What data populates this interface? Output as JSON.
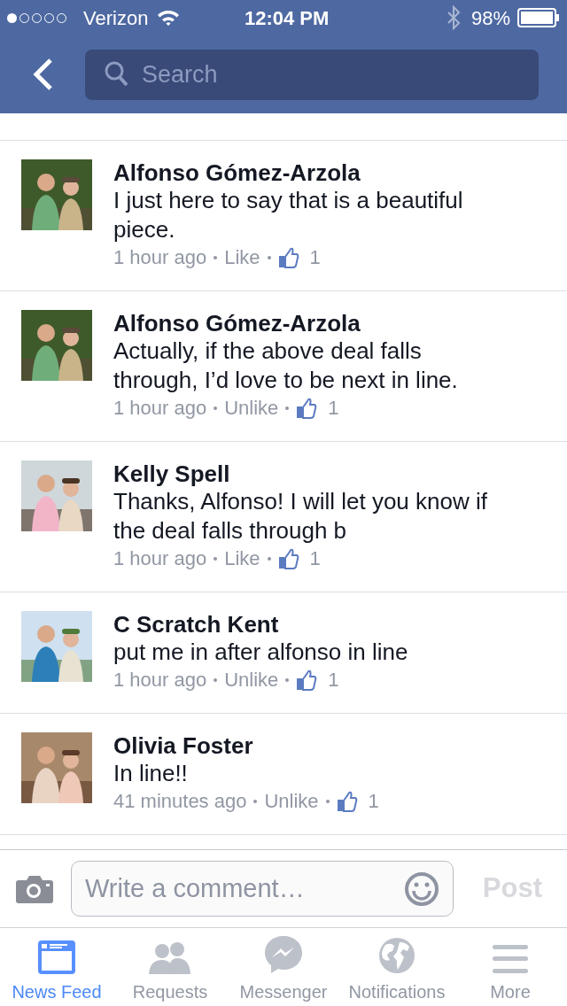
{
  "status_bar": {
    "carrier": "Verizon",
    "time": "12:04 PM",
    "battery": "98%"
  },
  "search": {
    "placeholder": "Search"
  },
  "comments": [
    {
      "author": "Alfonso Gómez-Arzola",
      "text": "I just here to say that is a beautiful piece.",
      "time": "1 hour ago",
      "action": "Like",
      "likes": "1"
    },
    {
      "author": "Alfonso Gómez-Arzola",
      "text": "Actually, if the above deal falls through, I’d love to be next in line.",
      "time": "1 hour ago",
      "action": "Unlike",
      "likes": "1"
    },
    {
      "author": "Kelly Spell",
      "text": "Thanks, Alfonso! I will let you know if the deal falls through b",
      "time": "1 hour ago",
      "action": "Like",
      "likes": "1"
    },
    {
      "author": "C Scratch Kent",
      "text": "put me in after alfonso in line",
      "time": "1 hour ago",
      "action": "Unlike",
      "likes": "1"
    },
    {
      "author": "Olivia Foster",
      "text": "In line!!",
      "time": "41 minutes ago",
      "action": "Unlike",
      "likes": "1"
    }
  ],
  "composer": {
    "placeholder": "Write a comment…",
    "post": "Post"
  },
  "tabs": [
    {
      "label": "News Feed",
      "kind": "feed",
      "selected": true
    },
    {
      "label": "Requests",
      "kind": "requests",
      "selected": false
    },
    {
      "label": "Messenger",
      "kind": "messenger",
      "selected": false
    },
    {
      "label": "Notifications",
      "kind": "globe",
      "selected": false
    },
    {
      "label": "More",
      "kind": "more",
      "selected": false
    }
  ]
}
